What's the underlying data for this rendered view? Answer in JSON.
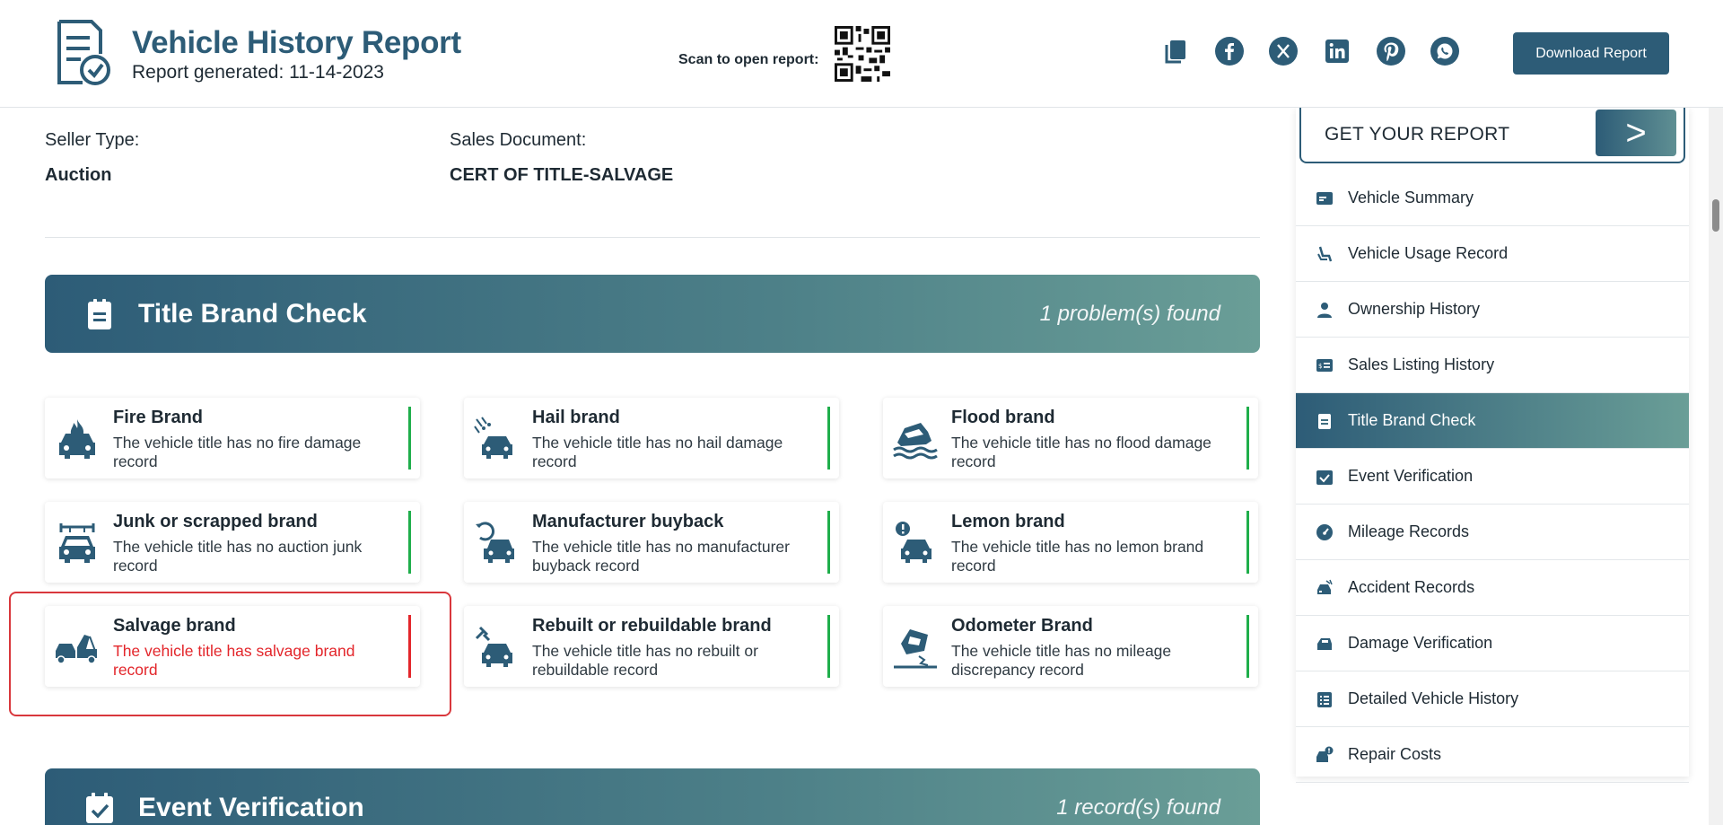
{
  "header": {
    "title": "Vehicle History Report",
    "subtitle": "Report generated: 11-14-2023",
    "scan_label": "Scan to open report:",
    "download_label": "Download Report",
    "share_icons": [
      "copy-icon",
      "facebook-icon",
      "x-twitter-icon",
      "linkedin-icon",
      "pinterest-icon",
      "whatsapp-icon"
    ]
  },
  "seller": {
    "seller_type_label": "Seller Type:",
    "seller_type_value": "Auction",
    "sales_doc_label": "Sales Document:",
    "sales_doc_value": "CERT OF TITLE-SALVAGE"
  },
  "title_brand": {
    "title": "Title Brand Check",
    "count": "1 problem(s) found",
    "cards": [
      {
        "title": "Fire Brand",
        "desc": "The vehicle title has no fire damage record",
        "icon": "fire-car-icon",
        "problem": false
      },
      {
        "title": "Hail brand",
        "desc": "The vehicle title has no hail damage record",
        "icon": "hail-car-icon",
        "problem": false
      },
      {
        "title": "Flood brand",
        "desc": "The vehicle title has no flood damage record",
        "icon": "flood-car-icon",
        "problem": false
      },
      {
        "title": "Junk or scrapped brand",
        "desc": "The vehicle title has no auction junk record",
        "icon": "junk-car-icon",
        "problem": false
      },
      {
        "title": "Manufacturer buyback",
        "desc": "The vehicle title has no manufacturer buyback record",
        "icon": "buyback-car-icon",
        "problem": false
      },
      {
        "title": "Lemon brand",
        "desc": "The vehicle title has no lemon brand record",
        "icon": "lemon-car-icon",
        "problem": false
      },
      {
        "title": "Salvage brand",
        "desc": "The vehicle title has salvage brand record",
        "icon": "tow-truck-icon",
        "problem": true
      },
      {
        "title": "Rebuilt or rebuildable brand",
        "desc": "The vehicle title has no rebuilt or rebuildable record",
        "icon": "rebuilt-car-icon",
        "problem": false
      },
      {
        "title": "Odometer Brand",
        "desc": "The vehicle title has no mileage discrepancy record",
        "icon": "odometer-car-icon",
        "problem": false
      }
    ]
  },
  "event_verification": {
    "title": "Event Verification",
    "count": "1 record(s) found"
  },
  "sidebar": {
    "get_report_label": "GET YOUR REPORT",
    "get_report_arrow": ">",
    "items": [
      {
        "label": "Vehicle Summary",
        "icon": "summary-icon",
        "active": false
      },
      {
        "label": "Vehicle Usage Record",
        "icon": "seat-icon",
        "active": false
      },
      {
        "label": "Ownership History",
        "icon": "person-icon",
        "active": false
      },
      {
        "label": "Sales Listing History",
        "icon": "price-tag-icon",
        "active": false
      },
      {
        "label": "Title Brand Check",
        "icon": "clipboard-icon",
        "active": true
      },
      {
        "label": "Event Verification",
        "icon": "calendar-check-icon",
        "active": false
      },
      {
        "label": "Mileage Records",
        "icon": "speedometer-icon",
        "active": false
      },
      {
        "label": "Accident Records",
        "icon": "crash-icon",
        "active": false
      },
      {
        "label": "Damage Verification",
        "icon": "car-side-icon",
        "active": false
      },
      {
        "label": "Detailed Vehicle History",
        "icon": "list-icon",
        "active": false
      },
      {
        "label": "Repair Costs",
        "icon": "repair-icon",
        "active": false
      }
    ]
  },
  "colors": {
    "brand": "#2d5c77",
    "ok": "#1fae4b",
    "problem": "#e3262b"
  }
}
